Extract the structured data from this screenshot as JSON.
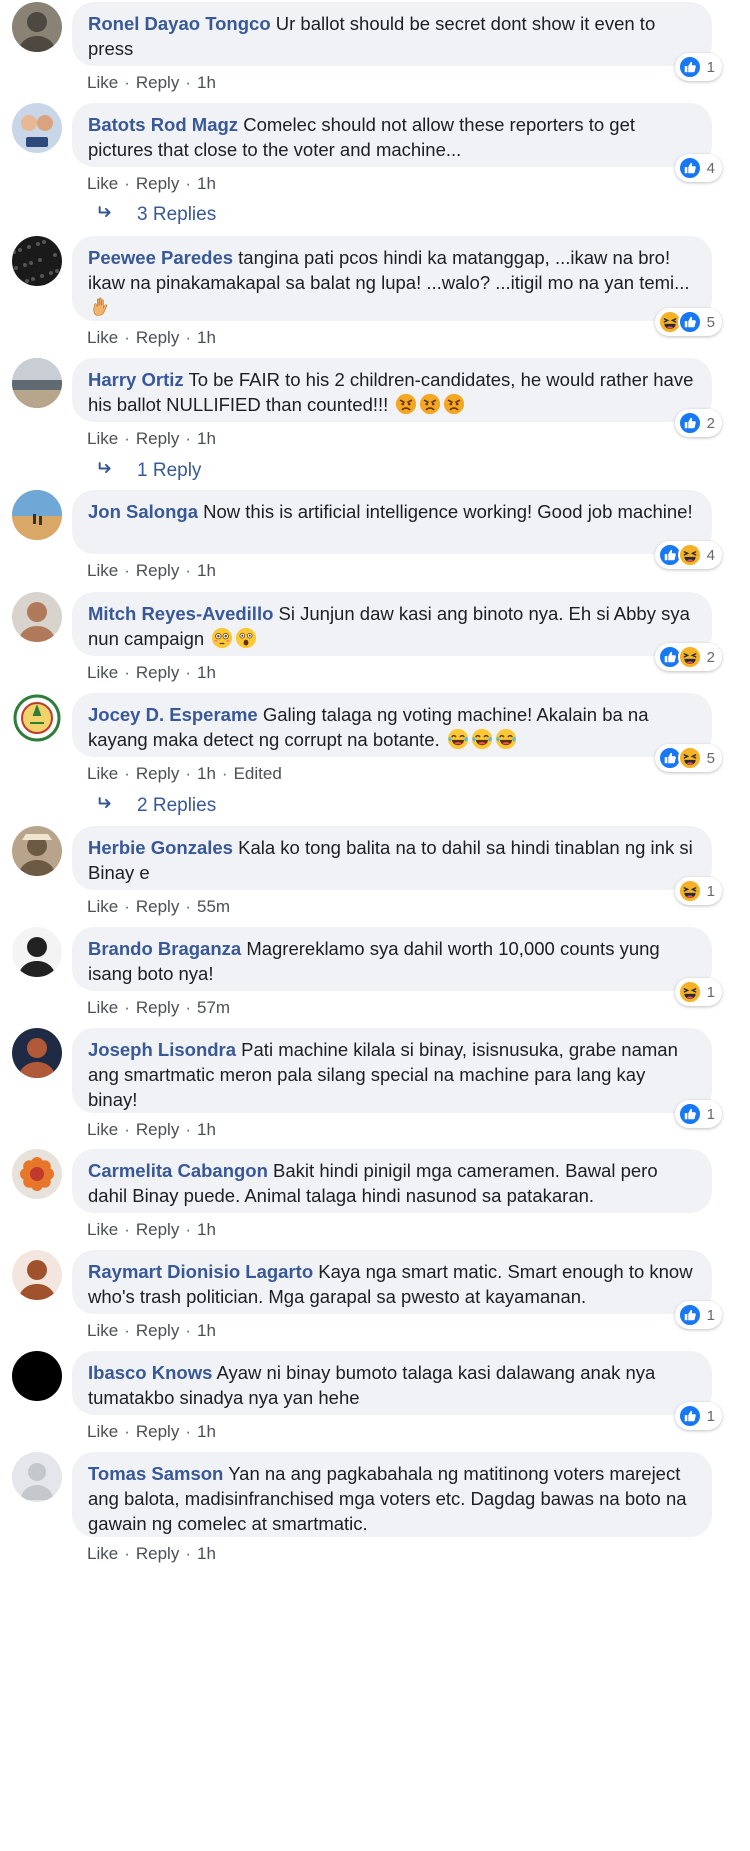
{
  "actions": {
    "like": "Like",
    "reply": "Reply",
    "separator": "·"
  },
  "colors": {
    "author": "#385898",
    "bubble": "#f0f2f5",
    "like_blue": "#1877f2",
    "haha_yellow": "#f7b125"
  },
  "comments": [
    {
      "author": "Ronel Dayao Tongco",
      "text": "Ur ballot should be secret dont show it even to press",
      "time": "1h",
      "edited": "",
      "reactions": [
        "like"
      ],
      "reaction_count": "1",
      "avatar": {
        "bg": "#8a8275",
        "fg": "#4d4840",
        "kind": "photo"
      },
      "emojis": [],
      "replies": ""
    },
    {
      "author": "Batots Rod Magz",
      "text": "Comelec should not allow these reporters to get pictures that close to the voter and machine...",
      "time": "1h",
      "edited": "",
      "reactions": [
        "like"
      ],
      "reaction_count": "4",
      "avatar": {
        "bg": "#c9d6e8",
        "fg": "#2e4a7d",
        "kind": "nurse"
      },
      "emojis": [],
      "replies": "3 Replies"
    },
    {
      "author": "Peewee Paredes",
      "text": "tangina pati pcos hindi ka matanggap, ...ikaw na bro! ikaw na pinakamakapal sa balat ng lupa! ...walo? ...itigil mo na yan temi...",
      "time": "1h",
      "edited": "",
      "reactions": [
        "haha",
        "like"
      ],
      "reaction_count": "5",
      "avatar": {
        "bg": "#1a1a1a",
        "fg": "#555555",
        "kind": "dark"
      },
      "emojis": [
        "hand"
      ],
      "replies": ""
    },
    {
      "author": "Harry Ortiz",
      "text": "To be FAIR to his 2 children-candidates, he would rather have his ballot NULLIFIED than counted!!!",
      "time": "1h",
      "edited": "",
      "reactions": [
        "like"
      ],
      "reaction_count": "2",
      "avatar": {
        "bg": "#9aa4ad",
        "fg": "#3f4549",
        "kind": "beach"
      },
      "emojis": [
        "angry",
        "angry",
        "angry"
      ],
      "replies": "1 Reply"
    },
    {
      "author": "Jon Salonga",
      "text": "Now this is artificial intelligence working! Good job machine!",
      "time": "1h",
      "edited": "",
      "reactions": [
        "like",
        "haha"
      ],
      "reaction_count": "4",
      "avatar": {
        "bg": "#d9a866",
        "fg": "#6fa8d6",
        "kind": "desert"
      },
      "emojis": [],
      "replies": ""
    },
    {
      "author": "Mitch Reyes-Avedillo",
      "text": "Si Junjun daw kasi ang binoto nya. Eh si Abby sya nun campaign",
      "time": "1h",
      "edited": "",
      "reactions": [
        "like",
        "haha"
      ],
      "reaction_count": "2",
      "avatar": {
        "bg": "#d8d3cc",
        "fg": "#b07a5a",
        "kind": "face"
      },
      "emojis": [
        "flushed",
        "astonished"
      ],
      "replies": ""
    },
    {
      "author": "Jocey D. Esperame",
      "text": "Galing talaga ng voting machine! Akalain ba na kayang maka detect ng corrupt na botante.",
      "time": "1h",
      "edited": "Edited",
      "reactions": [
        "like",
        "haha"
      ],
      "reaction_count": "5",
      "avatar": {
        "bg": "#ffffff",
        "fg": "#2f7d3a",
        "kind": "seal"
      },
      "emojis": [
        "joy",
        "joy",
        "joy"
      ],
      "replies": "2 Replies"
    },
    {
      "author": "Herbie Gonzales",
      "text": "Kala ko tong balita na to dahil sa hindi tinablan ng ink si Binay e",
      "time": "55m",
      "edited": "",
      "reactions": [
        "haha"
      ],
      "reaction_count": "1",
      "avatar": {
        "bg": "#b8a48a",
        "fg": "#6d5a45",
        "kind": "hat"
      },
      "emojis": [],
      "replies": ""
    },
    {
      "author": "Brando Braganza",
      "text": "Magrereklamo sya dahil worth 10,000 counts yung isang boto nya!",
      "time": "57m",
      "edited": "",
      "reactions": [
        "haha"
      ],
      "reaction_count": "1",
      "avatar": {
        "bg": "#f4f4f4",
        "fg": "#222222",
        "kind": "suit"
      },
      "emojis": [],
      "replies": ""
    },
    {
      "author": "Joseph Lisondra",
      "text": "Pati machine kilala si binay, isisnusuka, grabe naman ang smartmatic meron pala silang special na machine para lang kay binay!",
      "time": "1h",
      "edited": "",
      "reactions": [
        "like"
      ],
      "reaction_count": "1",
      "avatar": {
        "bg": "#1f2a44",
        "fg": "#b05a3a",
        "kind": "face"
      },
      "emojis": [],
      "replies": ""
    },
    {
      "author": "Carmelita Cabangon",
      "text": "Bakit hindi pinigil mga cameramen. Bawal pero dahil Binay puede. Animal talaga hindi nasunod sa patakaran.",
      "time": "1h",
      "edited": "",
      "reactions": [],
      "reaction_count": "",
      "avatar": {
        "bg": "#e8e2dc",
        "fg": "#e8762a",
        "kind": "flower"
      },
      "emojis": [],
      "replies": ""
    },
    {
      "author": "Raymart Dionisio Lagarto",
      "text": "Kaya nga smart matic. Smart enough to know who's trash politician. Mga garapal sa pwesto at kayamanan.",
      "time": "1h",
      "edited": "",
      "reactions": [
        "like"
      ],
      "reaction_count": "1",
      "avatar": {
        "bg": "#f3e6df",
        "fg": "#a0522d",
        "kind": "face"
      },
      "emojis": [],
      "replies": ""
    },
    {
      "author": "Ibasco Knows",
      "text": "Ayaw ni binay bumoto talaga kasi dalawang anak nya tumatakbo sinadya nya yan hehe",
      "time": "1h",
      "edited": "",
      "reactions": [
        "like"
      ],
      "reaction_count": "1",
      "avatar": {
        "bg": "#000000",
        "fg": "#000000",
        "kind": "dark"
      },
      "emojis": [],
      "replies": ""
    },
    {
      "author": "Tomas Samson",
      "text": "Yan na ang pagkabahala ng matitinong voters mareject ang balota, madisinfranchised mga voters etc. Dagdag bawas na boto na gawain ng comelec at smartmatic.",
      "time": "1h",
      "edited": "",
      "reactions": [],
      "reaction_count": "",
      "avatar": {
        "bg": "#e4e6eb",
        "fg": "#c4c7cc",
        "kind": "default"
      },
      "emojis": [],
      "replies": ""
    }
  ]
}
